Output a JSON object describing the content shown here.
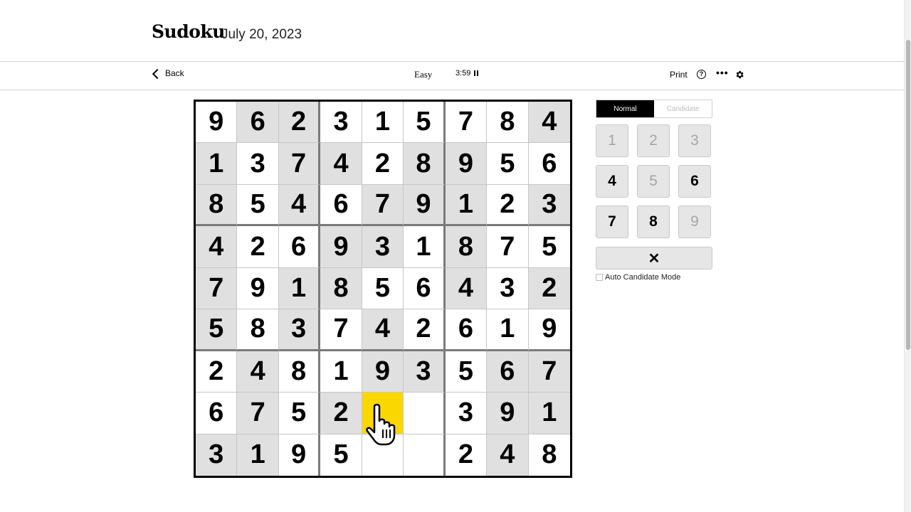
{
  "header": {
    "title": "Sudoku",
    "date": "July 20, 2023"
  },
  "toolbar": {
    "back_label": "Back",
    "difficulty": "Easy",
    "timer": "3:59",
    "print_label": "Print",
    "help_glyph": "?",
    "more_glyph": "•••"
  },
  "mode": {
    "normal_label": "Normal",
    "candidate_label": "Candidate",
    "active": "Normal"
  },
  "numpad": [
    {
      "label": "1",
      "enabled": false
    },
    {
      "label": "2",
      "enabled": false
    },
    {
      "label": "3",
      "enabled": false
    },
    {
      "label": "4",
      "enabled": true
    },
    {
      "label": "5",
      "enabled": false
    },
    {
      "label": "6",
      "enabled": true
    },
    {
      "label": "7",
      "enabled": true
    },
    {
      "label": "8",
      "enabled": true
    },
    {
      "label": "9",
      "enabled": false
    }
  ],
  "erase_glyph": "✕",
  "auto_candidate_label": "Auto Candidate Mode",
  "board": {
    "selected": [
      7,
      4
    ],
    "grid": [
      [
        "9",
        "6",
        "2",
        "3",
        "1",
        "5",
        "7",
        "8",
        "4"
      ],
      [
        "1",
        "3",
        "7",
        "4",
        "2",
        "8",
        "9",
        "5",
        "6"
      ],
      [
        "8",
        "5",
        "4",
        "6",
        "7",
        "9",
        "1",
        "2",
        "3"
      ],
      [
        "4",
        "2",
        "6",
        "9",
        "3",
        "1",
        "8",
        "7",
        "5"
      ],
      [
        "7",
        "9",
        "1",
        "8",
        "5",
        "6",
        "4",
        "3",
        "2"
      ],
      [
        "5",
        "8",
        "3",
        "7",
        "4",
        "2",
        "6",
        "1",
        "9"
      ],
      [
        "2",
        "4",
        "8",
        "1",
        "9",
        "3",
        "5",
        "6",
        "7"
      ],
      [
        "6",
        "7",
        "5",
        "2",
        "",
        "",
        "3",
        "9",
        "1"
      ],
      [
        "3",
        "1",
        "9",
        "5",
        "",
        "",
        "2",
        "4",
        "8"
      ]
    ],
    "shaded": [
      [
        0,
        1
      ],
      [
        0,
        2
      ],
      [
        0,
        8
      ],
      [
        1,
        0
      ],
      [
        1,
        2
      ],
      [
        1,
        3
      ],
      [
        1,
        5
      ],
      [
        1,
        6
      ],
      [
        2,
        0
      ],
      [
        2,
        2
      ],
      [
        2,
        4
      ],
      [
        2,
        5
      ],
      [
        2,
        6
      ],
      [
        2,
        8
      ],
      [
        3,
        0
      ],
      [
        3,
        3
      ],
      [
        3,
        4
      ],
      [
        3,
        6
      ],
      [
        4,
        0
      ],
      [
        4,
        2
      ],
      [
        4,
        3
      ],
      [
        4,
        6
      ],
      [
        4,
        8
      ],
      [
        5,
        0
      ],
      [
        5,
        2
      ],
      [
        5,
        4
      ],
      [
        6,
        1
      ],
      [
        6,
        4
      ],
      [
        6,
        5
      ],
      [
        6,
        7
      ],
      [
        6,
        8
      ],
      [
        7,
        1
      ],
      [
        7,
        3
      ],
      [
        7,
        7
      ],
      [
        7,
        8
      ],
      [
        8,
        0
      ],
      [
        8,
        1
      ],
      [
        8,
        7
      ]
    ]
  },
  "colors": {
    "selected": "#fbd700",
    "shaded": "#e0e0e0",
    "grid_line": "#c6c6c6",
    "box_line": "#7a7a7a"
  },
  "icons": {
    "back": "chevron-left-icon",
    "pause": "pause-icon",
    "help": "help-circle-icon",
    "more": "more-icon",
    "settings": "gear-icon",
    "cursor": "hand-pointer-icon"
  }
}
